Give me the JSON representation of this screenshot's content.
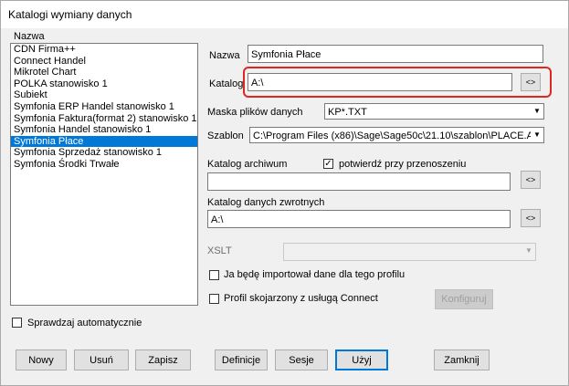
{
  "window": {
    "title": "Katalogi wymiany danych"
  },
  "list": {
    "header": "Nazwa",
    "items": [
      "CDN Firma++",
      "Connect Handel",
      "Mikrotel Chart",
      "POLKA stanowisko 1",
      "Subiekt",
      "Symfonia ERP Handel stanowisko 1",
      "Symfonia Faktura(format 2) stanowisko 1",
      "Symfonia Handel stanowisko 1",
      "Symfonia Płace",
      "Symfonia Sprzedaż stanowisko 1",
      "Symfonia Środki Trwałe"
    ],
    "selected": "Symfonia Płace"
  },
  "form": {
    "nazwa_label": "Nazwa",
    "nazwa_value": "Symfonia Płace",
    "katalog_label": "Katalog",
    "katalog_value": "A:\\",
    "maska_label": "Maska plików danych",
    "maska_value": "KP*.TXT",
    "szablon_label": "Szablon",
    "szablon_value": "C:\\Program Files (x86)\\Sage\\Sage50c\\21.10\\szablon\\PLACE.A",
    "archiwum_label": "Katalog archiwum",
    "potwierdz_label": "potwierdź przy przenoszeniu",
    "potwierdz_checked": true,
    "archiwum_value": "",
    "zwrotnych_label": "Katalog danych zwrotnych",
    "zwrotnych_value": "A:\\",
    "xslt_label": "XSLT",
    "xslt_value": "",
    "import_label": "Ja będę importował dane dla tego profilu",
    "import_checked": false,
    "connect_label": "Profil skojarzony z usługą Connect",
    "connect_checked": false,
    "konfiguruj_label": "Konfiguruj",
    "browse_label": "<>",
    "check_mark": "✓"
  },
  "auto_check": {
    "label": "Sprawdzaj automatycznie",
    "checked": false
  },
  "buttons": {
    "nowy": "Nowy",
    "usun": "Usuń",
    "zapisz": "Zapisz",
    "definicje": "Definicje",
    "sesje": "Sesje",
    "uzyj": "Użyj",
    "zamknij": "Zamknij"
  },
  "colors": {
    "selection": "#0078d7",
    "highlight": "#e0271f"
  }
}
